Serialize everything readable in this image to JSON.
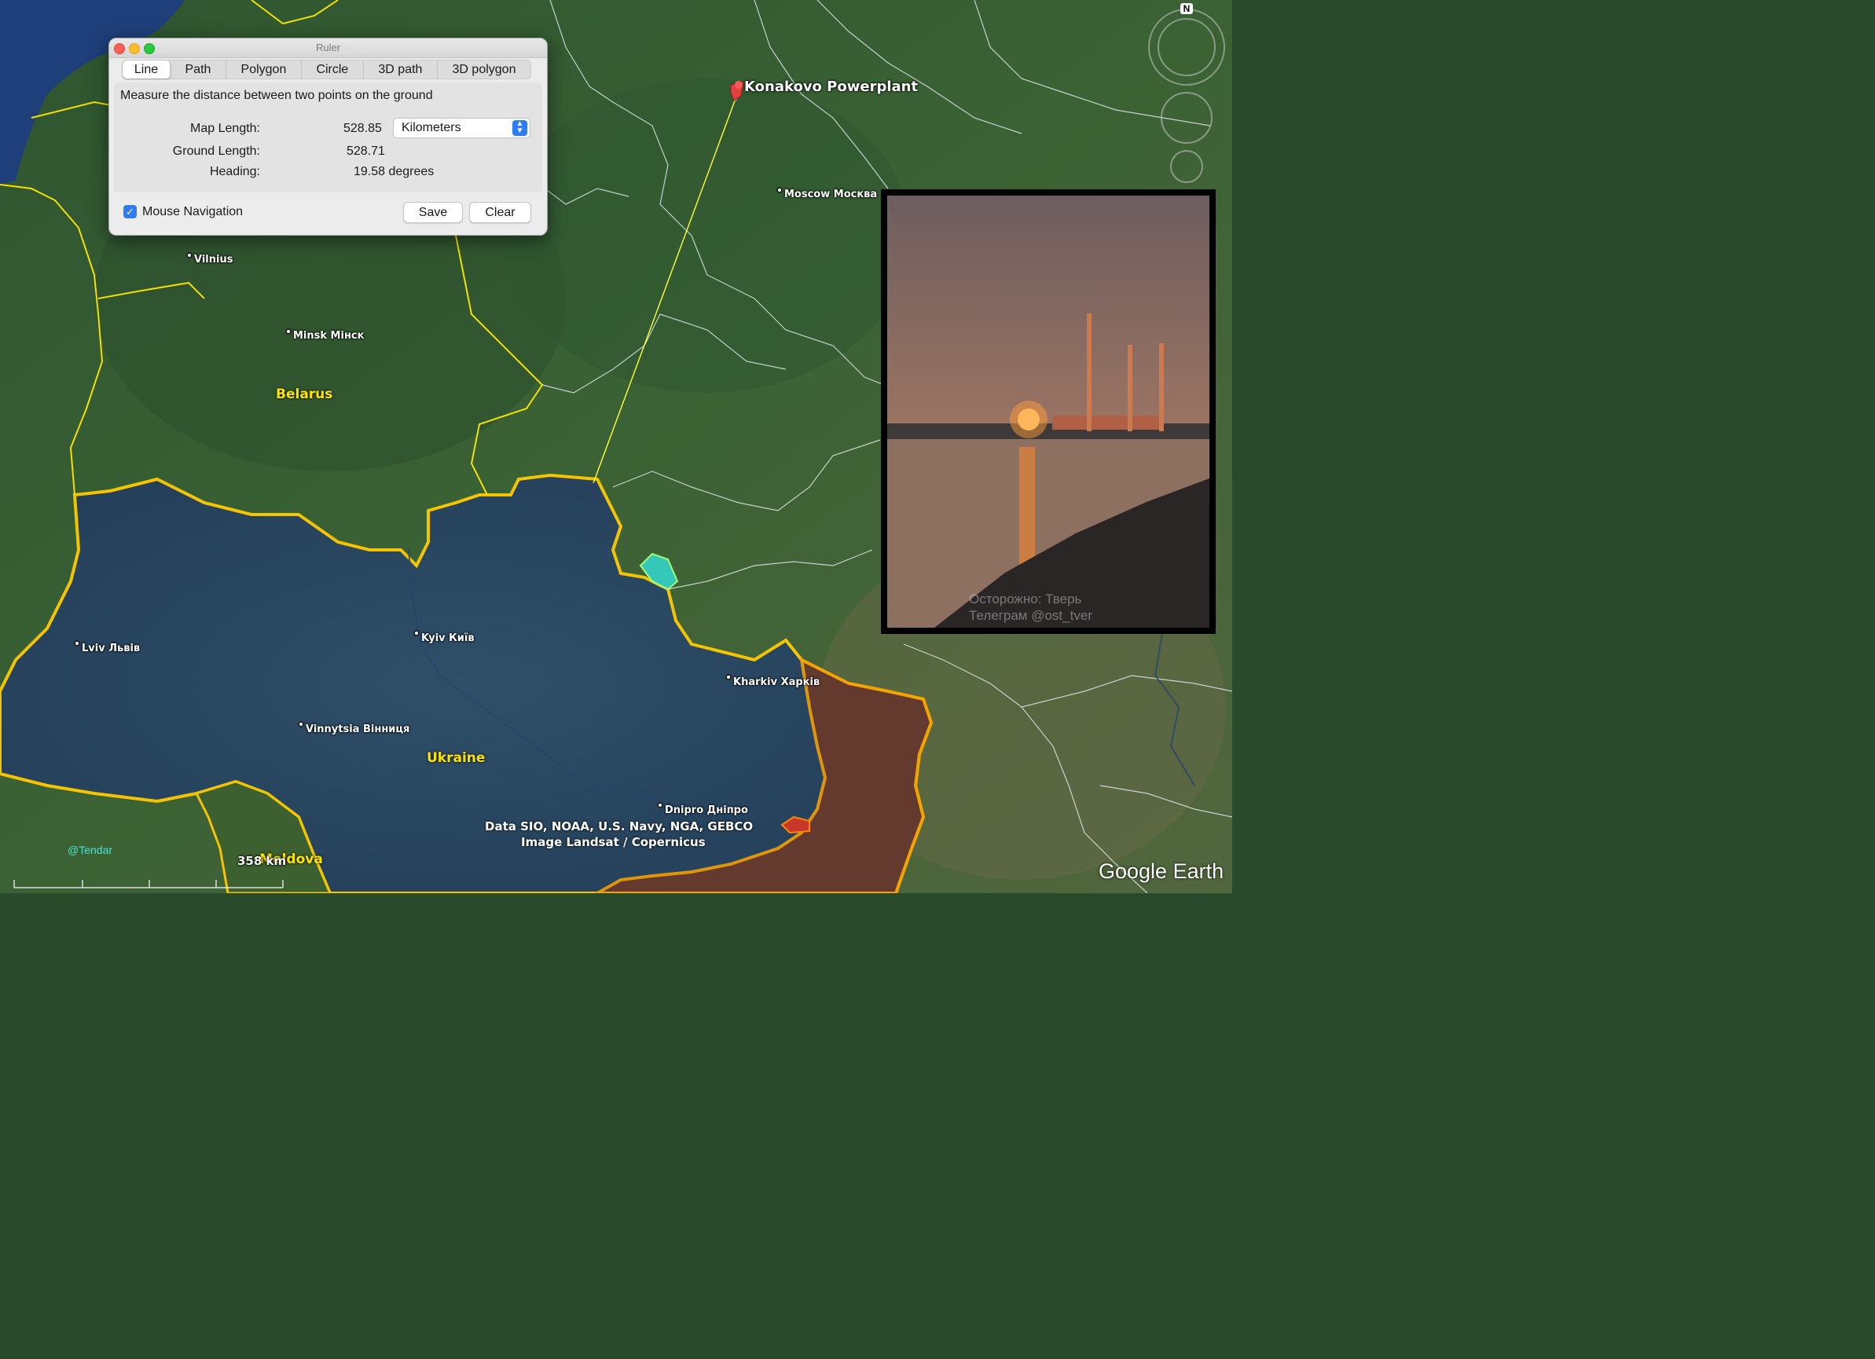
{
  "ruler": {
    "title": "Ruler",
    "tabs": [
      "Line",
      "Path",
      "Polygon",
      "Circle",
      "3D path",
      "3D polygon"
    ],
    "active_tab": "Line",
    "description": "Measure the distance between two points on the ground",
    "map_length_label": "Map Length:",
    "map_length_value": "528.85",
    "unit": "Kilometers",
    "ground_length_label": "Ground Length:",
    "ground_length_value": "528.71",
    "heading_label": "Heading:",
    "heading_value": "19.58 degrees",
    "mouse_navigation_label": "Mouse Navigation",
    "mouse_navigation_checked": true,
    "save_label": "Save",
    "clear_label": "Clear"
  },
  "placemark": {
    "label": "Konakovo Powerplant"
  },
  "cities": {
    "moscow": "Moscow Москва",
    "vilnius": "Vilnius",
    "minsk": "Minsk Мінск",
    "kyiv": "Kyiv Київ",
    "lviv": "Lviv Львів",
    "kharkiv": "Kharkiv Харків",
    "vinnytsia": "Vinnytsia Вінниця",
    "dnipro": "Dnipro Дніпро"
  },
  "countries": {
    "belarus": "Belarus",
    "ukraine": "Ukraine",
    "moldova": "Moldova"
  },
  "photo": {
    "watermark_line1": "Осторожно: Тверь",
    "watermark_line2": "Телеграм @ost_tver"
  },
  "attribution": {
    "line1": "Data SIO, NOAA, U.S. Navy, NGA, GEBCO",
    "line2": "Image Landsat / Copernicus"
  },
  "scale_label": "358 km",
  "handle": "@Tendar",
  "brand": "Google Earth",
  "compass_label": "N"
}
